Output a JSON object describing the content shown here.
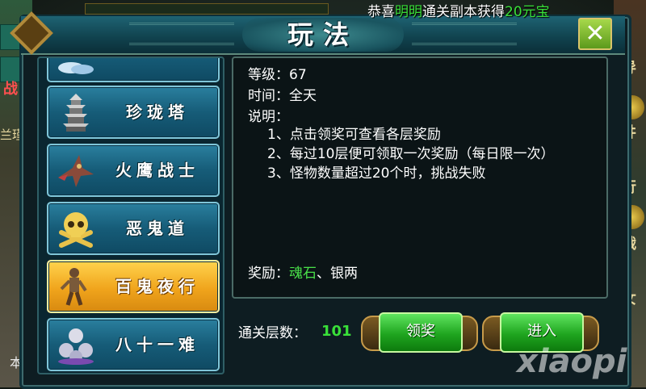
{
  "broadcast": {
    "prefix": "恭喜",
    "player": "明明",
    "middle": "通关副本获得",
    "reward": "20元宝"
  },
  "panel": {
    "title": "玩法",
    "close_label": "✕"
  },
  "activity_list": [
    {
      "label": "",
      "icon": "cloud-icon",
      "state": "partial"
    },
    {
      "label": "珍珑塔",
      "icon": "pagoda-icon",
      "state": "normal"
    },
    {
      "label": "火鹰战士",
      "icon": "eagle-icon",
      "state": "normal"
    },
    {
      "label": "恶鬼道",
      "icon": "skull-icon",
      "state": "normal"
    },
    {
      "label": "百鬼夜行",
      "icon": "ghost-icon",
      "state": "selected"
    },
    {
      "label": "八十一难",
      "icon": "skulls-pile-icon",
      "state": "normal"
    }
  ],
  "details": {
    "level_label": "等级：",
    "level_value": "67",
    "time_label": "时间：",
    "time_value": "全天",
    "desc_label": "说明：",
    "rules": [
      "1、点击领奖可查看各层奖励",
      "2、每过10层便可领取一次奖励（每日限一次）",
      "3、怪物数量超过20个时，挑战失败"
    ],
    "reward_label": "奖励：",
    "reward_primary": "魂石",
    "reward_sep": "、",
    "reward_secondary": "银两"
  },
  "footer": {
    "cleared_label": "通关层数：",
    "cleared_value": "101",
    "claim_button": "领奖",
    "enter_button": "进入"
  },
  "background": {
    "left_chars": [
      "战",
      "兰瑾",
      "本"
    ],
    "right_chars": [
      "导",
      "井",
      "行",
      "战",
      "女"
    ],
    "watermark": "xiaopi"
  },
  "colors": {
    "highlight_green": "#39e039",
    "panel_teal": "#1e6373",
    "selected_gold": "#f0a41c"
  }
}
